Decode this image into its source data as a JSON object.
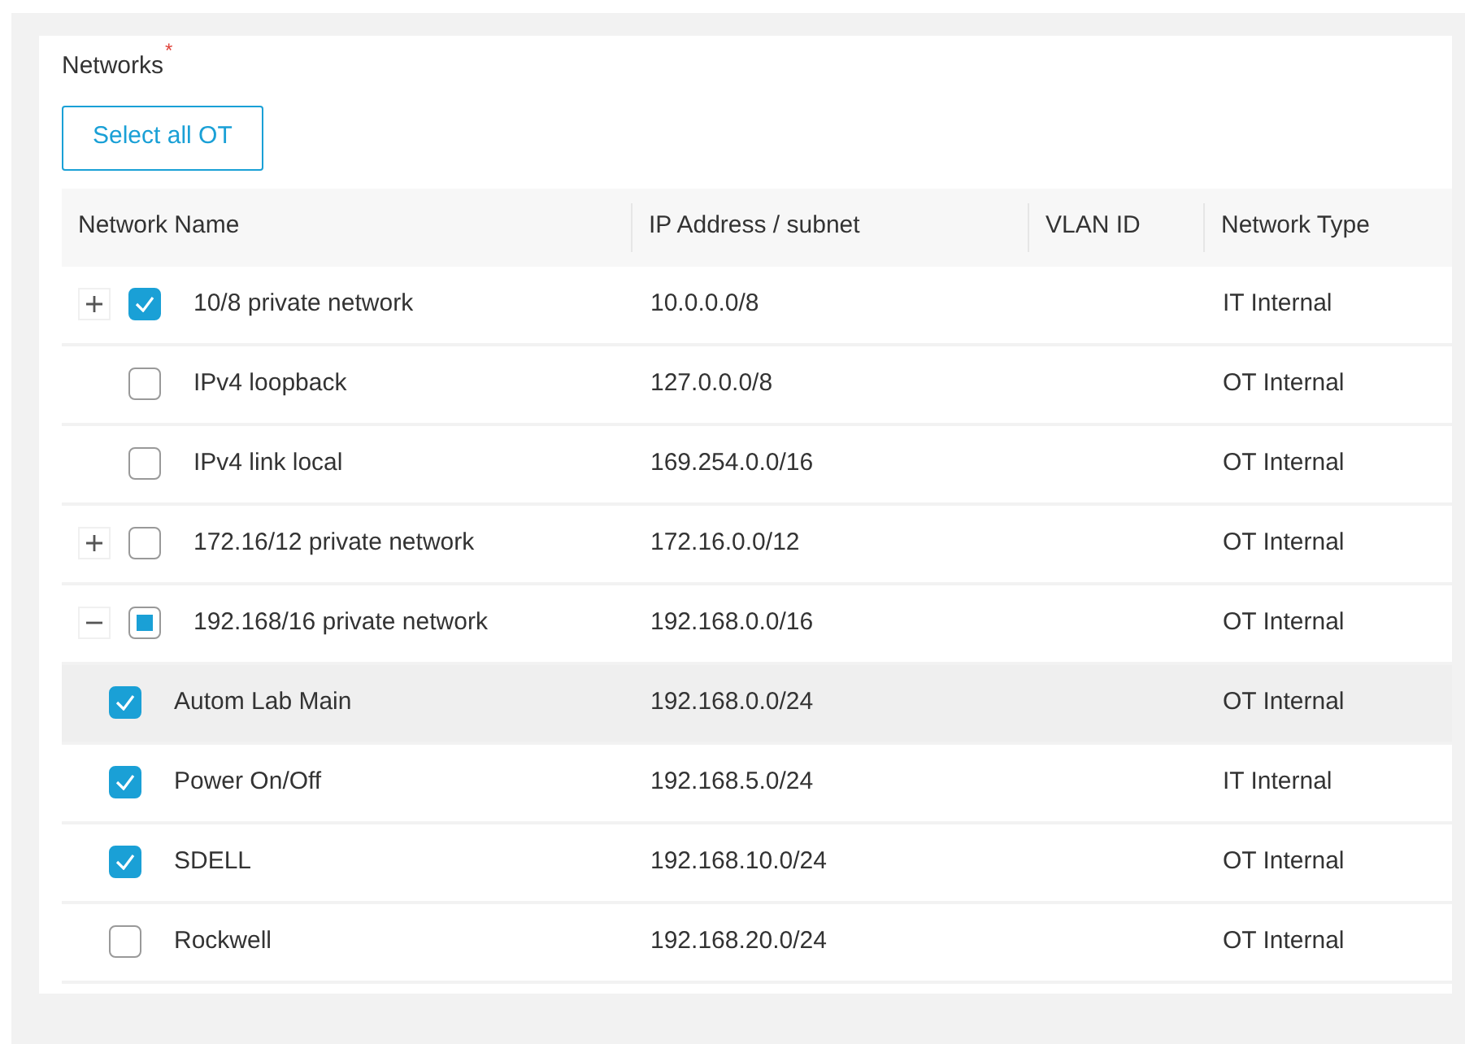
{
  "section": {
    "label": "Networks",
    "required_mark": "*"
  },
  "button": "Select all OT",
  "table": {
    "columns": [
      "Network Name",
      "IP Address / subnet",
      "VLAN ID",
      "Network Type"
    ],
    "rows": [
      {
        "expanded": false,
        "checked": true,
        "highlighted": false,
        "name": "10/8 private network",
        "ip": "10.0.0.0/8",
        "type": "IT Internal"
      },
      {
        "checked": false,
        "highlighted": false,
        "name": "IPv4 loopback",
        "ip": "127.0.0.0/8",
        "type": "OT Internal"
      },
      {
        "checked": false,
        "highlighted": false,
        "name": "IPv4 link local",
        "ip": "169.254.0.0/16",
        "type": "OT Internal"
      },
      {
        "expanded": false,
        "checked": false,
        "highlighted": false,
        "name": "172.16/12 private network",
        "ip": "172.16.0.0/12",
        "type": "OT Internal"
      },
      {
        "expanded": true,
        "checked": false,
        "highlighted": false,
        "name": "192.168/16 private network",
        "ip": "192.168.0.0/16",
        "type": "OT Internal",
        "children": [
          {
            "checked": true,
            "highlighted": true,
            "name": "Autom Lab Main",
            "ip": "192.168.0.0/24",
            "type": "OT Internal"
          },
          {
            "checked": true,
            "highlighted": false,
            "name": "Power On/Off",
            "ip": "192.168.5.0/24",
            "type": "IT Internal"
          },
          {
            "checked": true,
            "highlighted": false,
            "name": "SDELL",
            "ip": "192.168.10.0/24",
            "type": "OT Internal"
          },
          {
            "checked": false,
            "highlighted": false,
            "name": "Rockwell",
            "ip": "192.168.20.0/24",
            "type": "OT Internal"
          }
        ]
      }
    ]
  }
}
